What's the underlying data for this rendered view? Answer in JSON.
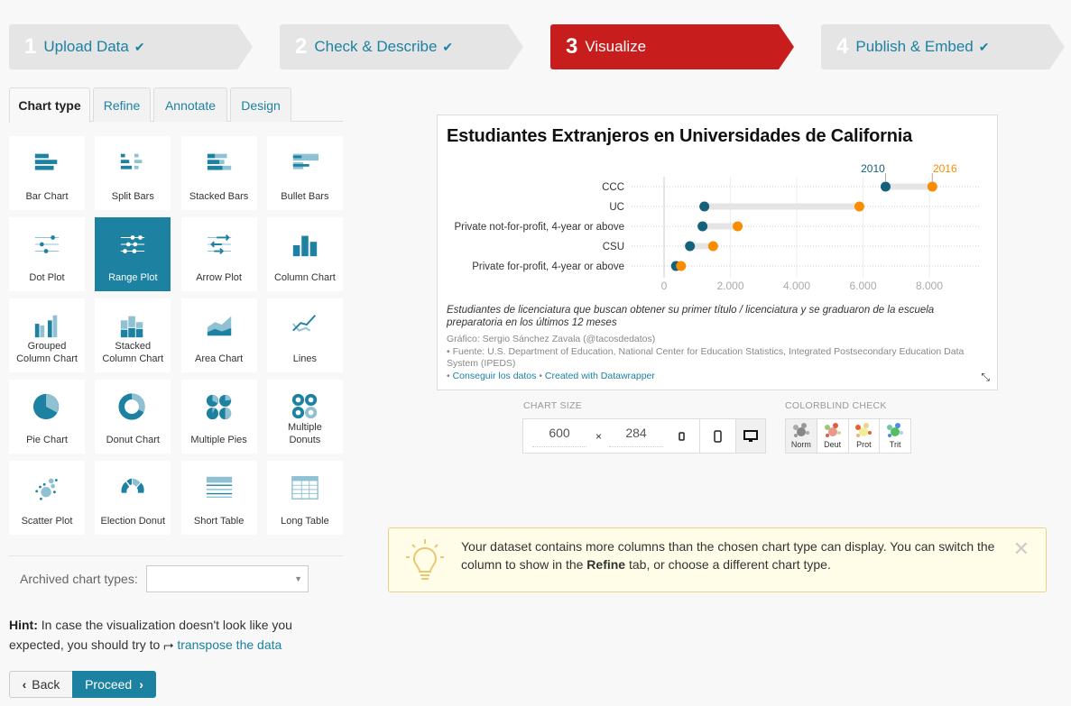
{
  "steps": [
    {
      "num": "1",
      "label": "Upload Data",
      "done": true
    },
    {
      "num": "2",
      "label": "Check & Describe",
      "done": true
    },
    {
      "num": "3",
      "label": "Visualize",
      "done": false,
      "active": true
    },
    {
      "num": "4",
      "label": "Publish & Embed",
      "done": true
    }
  ],
  "tabs": [
    {
      "label": "Chart type",
      "active": true
    },
    {
      "label": "Refine"
    },
    {
      "label": "Annotate"
    },
    {
      "label": "Design"
    }
  ],
  "chart_types": [
    {
      "label": "Bar Chart",
      "icon": "bar-chart-icon"
    },
    {
      "label": "Split Bars",
      "icon": "split-bars-icon"
    },
    {
      "label": "Stacked Bars",
      "icon": "stacked-bars-icon"
    },
    {
      "label": "Bullet Bars",
      "icon": "bullet-bars-icon"
    },
    {
      "label": "Dot Plot",
      "icon": "dot-plot-icon"
    },
    {
      "label": "Range Plot",
      "icon": "range-plot-icon",
      "selected": true
    },
    {
      "label": "Arrow Plot",
      "icon": "arrow-plot-icon"
    },
    {
      "label": "Column Chart",
      "icon": "column-chart-icon"
    },
    {
      "label": "Grouped Column Chart",
      "icon": "grouped-column-icon"
    },
    {
      "label": "Stacked Column Chart",
      "icon": "stacked-column-icon"
    },
    {
      "label": "Area Chart",
      "icon": "area-chart-icon"
    },
    {
      "label": "Lines",
      "icon": "lines-icon"
    },
    {
      "label": "Pie Chart",
      "icon": "pie-chart-icon"
    },
    {
      "label": "Donut Chart",
      "icon": "donut-chart-icon"
    },
    {
      "label": "Multiple Pies",
      "icon": "multiple-pies-icon"
    },
    {
      "label": "Multiple Donuts",
      "icon": "multiple-donuts-icon"
    },
    {
      "label": "Scatter Plot",
      "icon": "scatter-plot-icon"
    },
    {
      "label": "Election Donut",
      "icon": "election-donut-icon"
    },
    {
      "label": "Short Table",
      "icon": "short-table-icon"
    },
    {
      "label": "Long Table",
      "icon": "long-table-icon"
    }
  ],
  "archived": {
    "label": "Archived chart types:",
    "value": ""
  },
  "hint": {
    "bold": "Hint:",
    "text": " In case the visualization doesn't look like you expected, you should try to ",
    "link": "transpose the data"
  },
  "buttons": {
    "back": "Back",
    "proceed": "Proceed"
  },
  "chart": {
    "title": "Estudiantes Extranjeros en Universidades de California",
    "notes": "Estudiantes de licenciatura que buscan obtener su primer título / licenciatura y se graduaron de la escuela preparatoria en los últimos 12 meses",
    "byline": "Gráfico: Sergio Sánchez Zavala (@tacosdedatos)",
    "source": "• Fuente: U.S. Department of Education, National Center for Education Statistics, Integrated Postsecondary Education Data System (IPEDS)",
    "get_data": "Conseguir los datos",
    "created_with": "Created with Datawrapper",
    "sep": " • "
  },
  "chart_data": {
    "type": "range",
    "title": "Estudiantes Extranjeros en Universidades de California",
    "categories": [
      "CCC",
      "UC",
      "Private not-for-profit, 4-year or above",
      "CSU",
      "Private for-profit, 4-year or above"
    ],
    "series": [
      {
        "name": "2010",
        "color": "#15607a",
        "values": [
          6680,
          1215,
          1160,
          780,
          360
        ]
      },
      {
        "name": "2016",
        "color": "#fa8c00",
        "values": [
          8090,
          5890,
          2220,
          1480,
          510
        ]
      }
    ],
    "xticks": [
      0,
      2000,
      4000,
      6000,
      8000
    ],
    "xtick_labels": [
      "0",
      "2.000",
      "4.000",
      "6.000",
      "8.000"
    ],
    "xlim": [
      0,
      9500
    ],
    "grid": true
  },
  "chart_size": {
    "label": "CHART SIZE",
    "width": "600",
    "height": "284",
    "x": "×"
  },
  "colorblind": {
    "label": "COLORBLIND CHECK",
    "modes": [
      "Norm",
      "Deut",
      "Prot",
      "Trit"
    ]
  },
  "alert": {
    "pre": "Your dataset contains more columns than the chosen chart type can display. You can switch the column to show in the ",
    "bold": "Refine",
    "post": " tab, or choose a different chart type."
  }
}
